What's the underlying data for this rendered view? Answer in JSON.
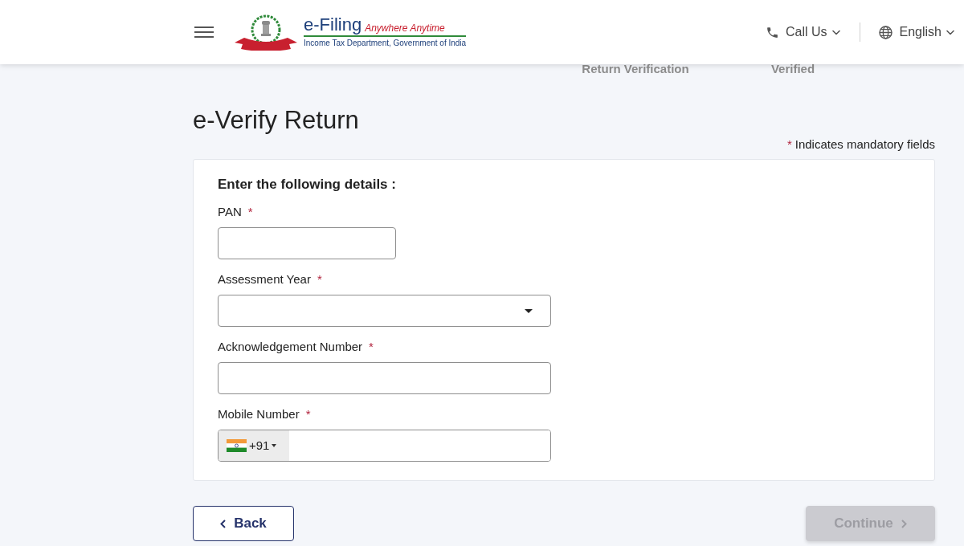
{
  "header": {
    "brand": {
      "title": "e-Filing",
      "tagline": "Anywhere Anytime",
      "subtitle": "Income Tax Department, Government of India"
    },
    "menu": [
      {
        "kind": "call",
        "label": "Call Us"
      },
      {
        "kind": "language",
        "label": "English"
      }
    ]
  },
  "stepper": [
    {
      "label": "Return Verification"
    },
    {
      "label": "Verified"
    }
  ],
  "page_title": "e-Verify Return",
  "mandatory_note": {
    "mark": "*",
    "text": "Indicates mandatory fields"
  },
  "form": {
    "heading": "Enter the following details :",
    "required_mark": "*",
    "fields": [
      {
        "kind": "text",
        "label": "PAN",
        "required": true
      },
      {
        "kind": "select",
        "label": "Assessment Year",
        "required": true
      },
      {
        "kind": "text",
        "label": "Acknowledgement Number",
        "required": true
      },
      {
        "kind": "phone",
        "label": "Mobile Number",
        "required": true,
        "country_code": "+91"
      }
    ]
  },
  "buttons": [
    {
      "kind": "back",
      "label": "Back",
      "disabled": false
    },
    {
      "kind": "continue",
      "label": "Continue",
      "disabled": true
    }
  ]
}
